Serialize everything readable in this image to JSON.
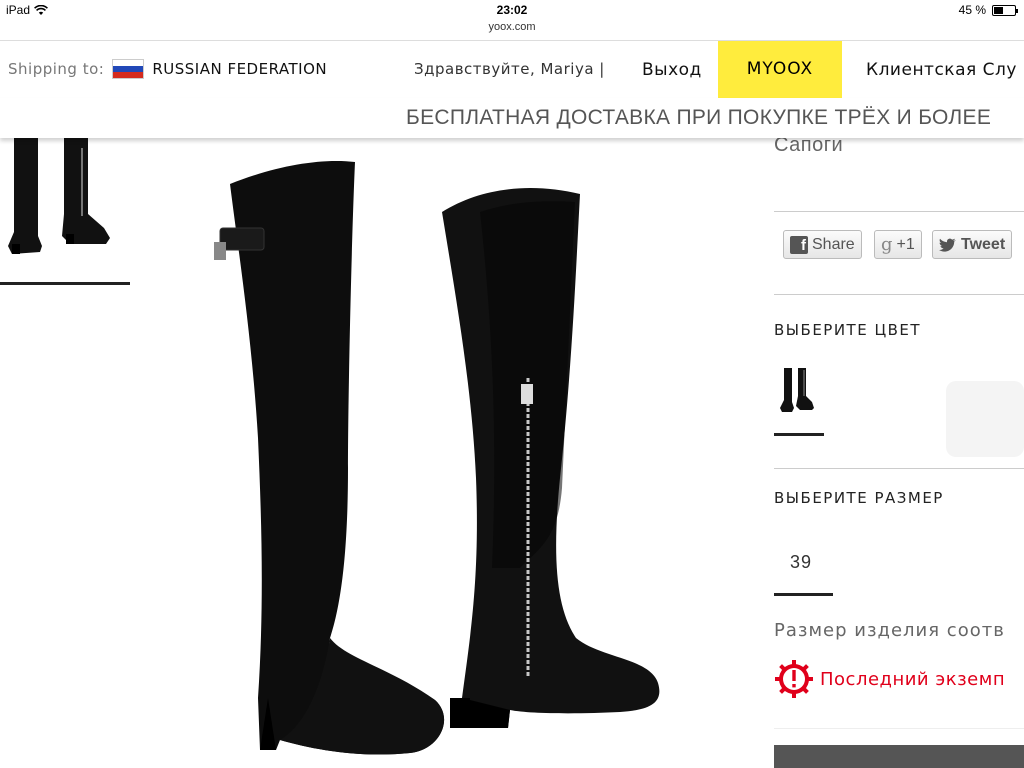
{
  "status_bar": {
    "device": "iPad",
    "time": "23:02",
    "battery": "45 %",
    "battery_level": 0.45,
    "url": "yoox.com"
  },
  "topnav": {
    "shipping_label": "Shipping to:",
    "country": "RUSSIAN FEDERATION",
    "greeting": "Здравствуйте, Mariya |",
    "logout": "Выход",
    "myoox": "MYOOX",
    "support": "Клиентская Слу"
  },
  "promo": {
    "text": "БЕСПЛАТНАЯ ДОСТАВКА ПРИ ПОКУПКЕ ТРЁХ И БОЛЕЕ"
  },
  "product": {
    "name": "Сапоги",
    "share": {
      "facebook": "Share",
      "google": "+1",
      "twitter": "Tweet"
    },
    "color_section_title": "ВЫБЕРИТЕ ЦВЕТ",
    "size_section_title": "ВЫБЕРИТЕ РАЗМЕР",
    "selected_size": "39",
    "size_fit_text": "Размер изделия соотв",
    "last_item_text": "Последний экземп"
  },
  "colors": {
    "accent_yellow": "#ffec3d",
    "alert_red": "#e0001b"
  },
  "icons": {
    "wifi": "wifi-icon",
    "battery": "battery-icon",
    "flag": "russia-flag-icon",
    "facebook": "facebook-icon",
    "google": "google-plus-icon",
    "twitter": "twitter-icon",
    "alert": "alert-gear-icon"
  }
}
